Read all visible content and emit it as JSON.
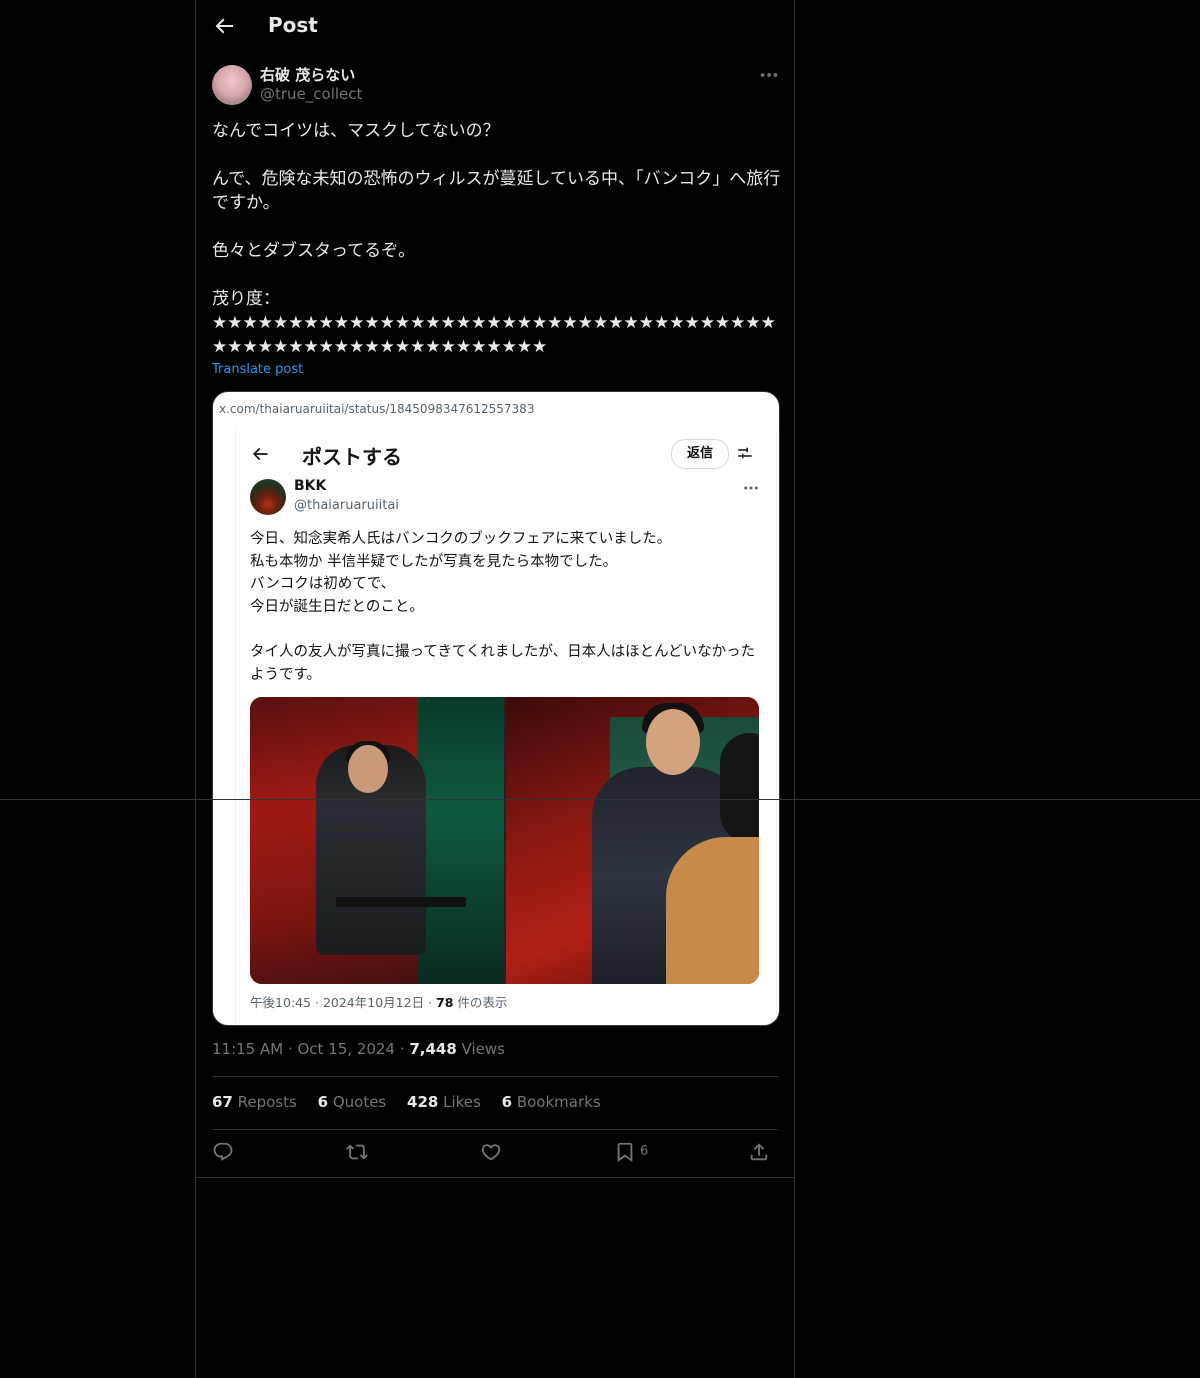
{
  "header": {
    "title": "Post"
  },
  "post": {
    "author_name": "右破 茂らない",
    "author_handle": "@true_collect",
    "text": "なんでコイツは、マスクしてないの？\n\nんで、危険な未知の恐怖のウィルスが蔓延している中、「バンコク」へ旅行ですか。\n\n色々とダブスタってるぞ。\n\n茂り度：\n★★★★★★★★★★★★★★★★★★★★★★★★★★★★★★★★★★★★★\n★★★★★★★★★★★★★★★★★★★★★★",
    "translate_label": "Translate post",
    "timestamp": "11:15 AM · Oct 15, 2024 · ",
    "views_count": "7,448",
    "views_label": " Views"
  },
  "embedded": {
    "url": "x.com/thaiaruaruiitai/status/1845098347612557383",
    "title": "ポストする",
    "reply_label": "返信",
    "author_name": "BKK",
    "author_handle": "@thaiaruaruiitai",
    "text": "今日、知念実希人氏はバンコクのブックフェアに来ていました。\n私も本物か 半信半疑でしたが写真を見たら本物でした。\nバンコクは初めてで、\n今日が誕生日だとのこと。\n\nタイ人の友人が写真に撮ってきてくれましたが、日本人はほとんどいなかったようです。",
    "meta_prefix": "午後10:45 · 2024年10月12日 · ",
    "meta_views": "78",
    "meta_suffix": " 件の表示"
  },
  "stats": [
    {
      "count": "67",
      "label": " Reposts"
    },
    {
      "count": "6",
      "label": " Quotes"
    },
    {
      "count": "428",
      "label": " Likes"
    },
    {
      "count": "6",
      "label": " Bookmarks"
    }
  ],
  "actions": {
    "bookmark_count": "6"
  },
  "icons": [
    "back-arrow-icon",
    "more-icon",
    "reply-icon",
    "repost-icon",
    "like-icon",
    "bookmark-icon",
    "share-icon",
    "adjust-icon"
  ],
  "colors": {
    "background": "#000000",
    "text": "#e7e9ea",
    "muted": "#71767b",
    "accent": "#1d9bf0",
    "border": "#2f3336"
  }
}
